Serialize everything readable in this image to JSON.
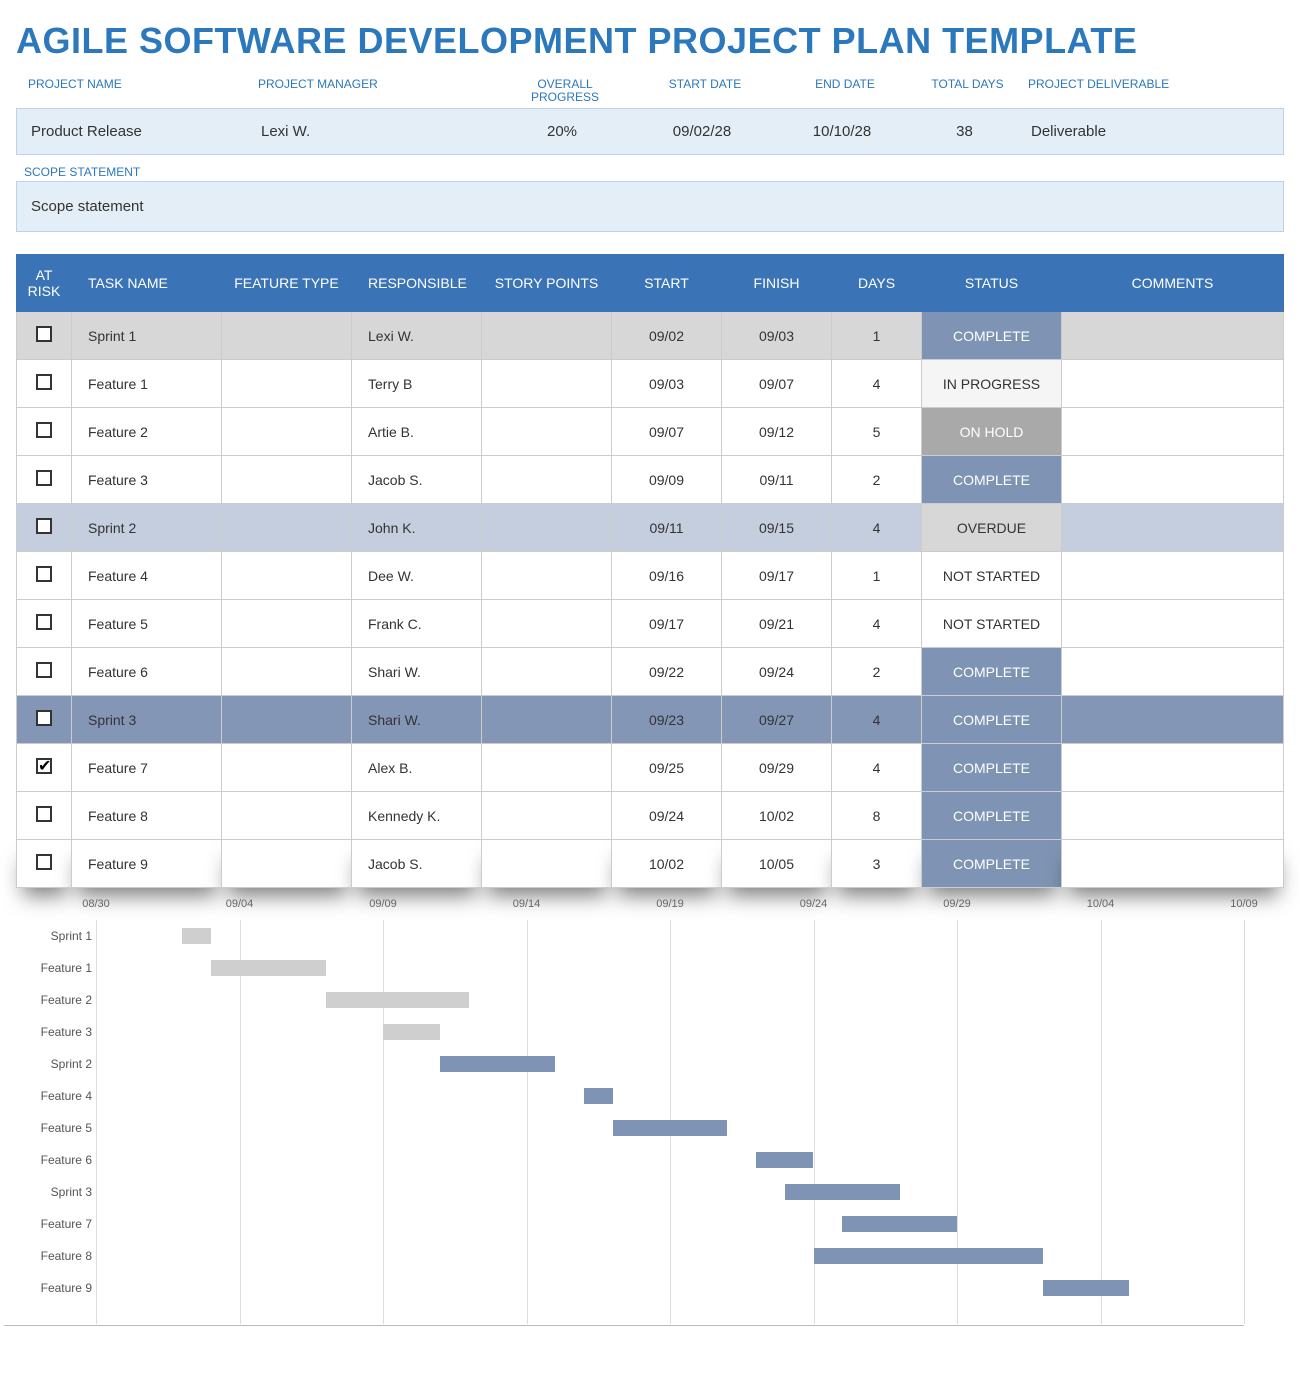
{
  "title": "AGILE SOFTWARE DEVELOPMENT PROJECT PLAN TEMPLATE",
  "meta": {
    "labels": {
      "project_name": "PROJECT NAME",
      "project_manager": "PROJECT MANAGER",
      "overall_progress": "OVERALL PROGRESS",
      "start_date": "START DATE",
      "end_date": "END DATE",
      "total_days": "TOTAL DAYS",
      "deliverable": "PROJECT DELIVERABLE"
    },
    "values": {
      "project_name": "Product Release",
      "project_manager": "Lexi W.",
      "overall_progress": "20%",
      "start_date": "09/02/28",
      "end_date": "10/10/28",
      "total_days": "38",
      "deliverable": "Deliverable"
    }
  },
  "scope": {
    "label": "SCOPE STATEMENT",
    "value": "Scope statement"
  },
  "columns": {
    "at_risk": "AT RISK",
    "task_name": "TASK NAME",
    "feature_type": "FEATURE TYPE",
    "responsible": "RESPONSIBLE",
    "story_points": "STORY POINTS",
    "start": "START",
    "finish": "FINISH",
    "days": "DAYS",
    "status": "STATUS",
    "comments": "COMMENTS"
  },
  "tasks": [
    {
      "at_risk": false,
      "name": "Sprint 1",
      "feature_type": "",
      "responsible": "Lexi W.",
      "points": "",
      "start": "09/02",
      "finish": "09/03",
      "days": "1",
      "status": "COMPLETE",
      "row_class": "sprint-1"
    },
    {
      "at_risk": false,
      "name": "Feature 1",
      "feature_type": "",
      "responsible": "Terry B",
      "points": "",
      "start": "09/03",
      "finish": "09/07",
      "days": "4",
      "status": "IN PROGRESS",
      "row_class": ""
    },
    {
      "at_risk": false,
      "name": "Feature 2",
      "feature_type": "",
      "responsible": "Artie B.",
      "points": "",
      "start": "09/07",
      "finish": "09/12",
      "days": "5",
      "status": "ON HOLD",
      "row_class": ""
    },
    {
      "at_risk": false,
      "name": "Feature 3",
      "feature_type": "",
      "responsible": "Jacob S.",
      "points": "",
      "start": "09/09",
      "finish": "09/11",
      "days": "2",
      "status": "COMPLETE",
      "row_class": ""
    },
    {
      "at_risk": false,
      "name": "Sprint 2",
      "feature_type": "",
      "responsible": "John K.",
      "points": "",
      "start": "09/11",
      "finish": "09/15",
      "days": "4",
      "status": "OVERDUE",
      "row_class": "sprint-2"
    },
    {
      "at_risk": false,
      "name": "Feature 4",
      "feature_type": "",
      "responsible": "Dee W.",
      "points": "",
      "start": "09/16",
      "finish": "09/17",
      "days": "1",
      "status": "NOT STARTED",
      "row_class": ""
    },
    {
      "at_risk": false,
      "name": "Feature 5",
      "feature_type": "",
      "responsible": "Frank C.",
      "points": "",
      "start": "09/17",
      "finish": "09/21",
      "days": "4",
      "status": "NOT STARTED",
      "row_class": ""
    },
    {
      "at_risk": false,
      "name": "Feature 6",
      "feature_type": "",
      "responsible": "Shari W.",
      "points": "",
      "start": "09/22",
      "finish": "09/24",
      "days": "2",
      "status": "COMPLETE",
      "row_class": ""
    },
    {
      "at_risk": false,
      "name": "Sprint 3",
      "feature_type": "",
      "responsible": "Shari W.",
      "points": "",
      "start": "09/23",
      "finish": "09/27",
      "days": "4",
      "status": "COMPLETE",
      "row_class": "sprint-3"
    },
    {
      "at_risk": true,
      "name": "Feature 7",
      "feature_type": "",
      "responsible": "Alex B.",
      "points": "",
      "start": "09/25",
      "finish": "09/29",
      "days": "4",
      "status": "COMPLETE",
      "row_class": ""
    },
    {
      "at_risk": false,
      "name": "Feature 8",
      "feature_type": "",
      "responsible": "Kennedy K.",
      "points": "",
      "start": "09/24",
      "finish": "10/02",
      "days": "8",
      "status": "COMPLETE",
      "row_class": ""
    },
    {
      "at_risk": false,
      "name": "Feature 9",
      "feature_type": "",
      "responsible": "Jacob S.",
      "points": "",
      "start": "10/02",
      "finish": "10/05",
      "days": "3",
      "status": "COMPLETE",
      "row_class": "shadow"
    }
  ],
  "chart_data": {
    "type": "gantt",
    "x_ticks": [
      "08/30",
      "09/04",
      "09/09",
      "09/14",
      "09/19",
      "09/24",
      "09/29",
      "10/04",
      "10/09"
    ],
    "x_range_days": {
      "min": 0,
      "max": 40
    },
    "rows": [
      {
        "label": "Sprint 1",
        "start_day": 3,
        "end_day": 4,
        "color": "grey"
      },
      {
        "label": "Feature 1",
        "start_day": 4,
        "end_day": 8,
        "color": "grey"
      },
      {
        "label": "Feature 2",
        "start_day": 8,
        "end_day": 13,
        "color": "grey"
      },
      {
        "label": "Feature 3",
        "start_day": 10,
        "end_day": 12,
        "color": "grey"
      },
      {
        "label": "Sprint 2",
        "start_day": 12,
        "end_day": 16,
        "color": "blue"
      },
      {
        "label": "Feature 4",
        "start_day": 17,
        "end_day": 18,
        "color": "blue"
      },
      {
        "label": "Feature 5",
        "start_day": 18,
        "end_day": 22,
        "color": "blue"
      },
      {
        "label": "Feature 6",
        "start_day": 23,
        "end_day": 25,
        "color": "blue"
      },
      {
        "label": "Sprint 3",
        "start_day": 24,
        "end_day": 28,
        "color": "blue"
      },
      {
        "label": "Feature 7",
        "start_day": 26,
        "end_day": 30,
        "color": "blue"
      },
      {
        "label": "Feature 8",
        "start_day": 25,
        "end_day": 33,
        "color": "blue"
      },
      {
        "label": "Feature 9",
        "start_day": 33,
        "end_day": 36,
        "color": "blue"
      }
    ]
  }
}
